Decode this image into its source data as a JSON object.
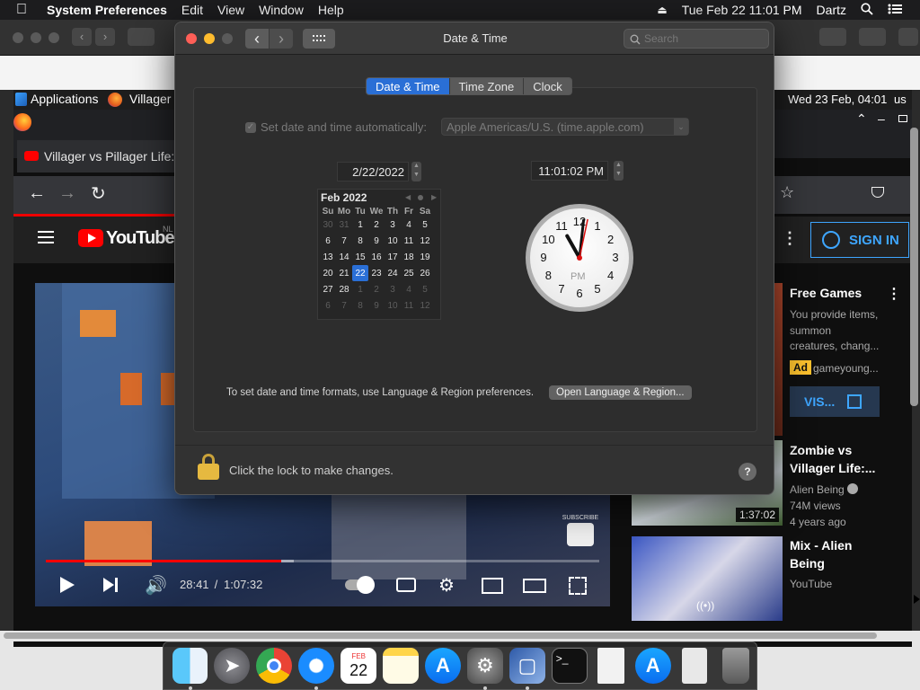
{
  "menubar": {
    "app": "System Preferences",
    "items": [
      "Edit",
      "View",
      "Window",
      "Help"
    ],
    "datetime": "Tue Feb 22  11:01 PM",
    "user": "Dartz"
  },
  "ubuntu": {
    "apps_label": "Applications",
    "firefox_tab_short": "Villager v",
    "clock": "Wed 23 Feb, 04:01",
    "locale": "us"
  },
  "firefox": {
    "tab_title": "Villager vs Pillager Life: F"
  },
  "youtube": {
    "logo": "YouTube",
    "region": "NL",
    "sign_in": "SIGN IN",
    "time_current": "28:41",
    "time_sep": " / ",
    "time_total": "1:07:32",
    "progress": 0.425,
    "subscribe": "SUBSCRIBE",
    "ad_title": "Free Games",
    "ad_desc": [
      "You provide items,",
      "summon",
      "creatures, chang..."
    ],
    "ad_badge": "Ad",
    "ad_channel": "gameyoung...",
    "ad_visit": "VIS...",
    "video1_title": [
      "Zombie vs",
      "Villager Life:..."
    ],
    "video1_channel": "Alien Being",
    "video1_views": "74M views",
    "video1_age": "4 years ago",
    "video1_duration": "1:37:02",
    "video2_title": [
      "Mix - Alien",
      "Being"
    ],
    "video2_channel": "YouTube"
  },
  "window": {
    "title": "Date & Time",
    "search_placeholder": "Search",
    "tabs": [
      "Date & Time",
      "Time Zone",
      "Clock"
    ],
    "active_tab": "Date & Time",
    "auto_label": "Set date and time automatically:",
    "auto_checked": true,
    "server": "Apple Americas/U.S. (time.apple.com)",
    "date_value": "2/22/2022",
    "time_value": "11:01:02 PM",
    "calendar": {
      "month": "Feb 2022",
      "weekdays": [
        "Su",
        "Mo",
        "Tu",
        "We",
        "Th",
        "Fr",
        "Sa"
      ],
      "weeks": [
        [
          "30",
          "31",
          "1",
          "2",
          "3",
          "4",
          "5"
        ],
        [
          "6",
          "7",
          "8",
          "9",
          "10",
          "11",
          "12"
        ],
        [
          "13",
          "14",
          "15",
          "16",
          "17",
          "18",
          "19"
        ],
        [
          "20",
          "21",
          "22",
          "23",
          "24",
          "25",
          "26"
        ],
        [
          "27",
          "28",
          "1",
          "2",
          "3",
          "4",
          "5"
        ],
        [
          "6",
          "7",
          "8",
          "9",
          "10",
          "11",
          "12"
        ]
      ],
      "selected": "22"
    },
    "clock": {
      "hour": 11,
      "minute": 1,
      "second": 2,
      "ampm": "PM",
      "numbers": [
        "12",
        "1",
        "2",
        "3",
        "4",
        "5",
        "6",
        "7",
        "8",
        "9",
        "10",
        "11"
      ]
    },
    "format_note": "To set date and time formats, use Language & Region preferences.",
    "open_button": "Open Language & Region...",
    "lock_text": "Click the lock to make changes.",
    "help": "?"
  },
  "dock": {
    "calendar_month": "FEB",
    "calendar_day": "22",
    "apps": [
      "finder-icon",
      "launchpad-icon",
      "chrome-icon",
      "safari-icon",
      "calendar-icon",
      "notes-icon",
      "app-store-icon",
      "system-preferences-icon",
      "virtualbox-icon",
      "terminal-icon",
      "text-document-icon",
      "app-store-icon-2",
      "disk-image-icon",
      "trash-icon"
    ]
  },
  "colors": {
    "accent": "#2a6fd6",
    "youtube_red": "#ff0000",
    "sign_in_blue": "#3ea6ff"
  }
}
